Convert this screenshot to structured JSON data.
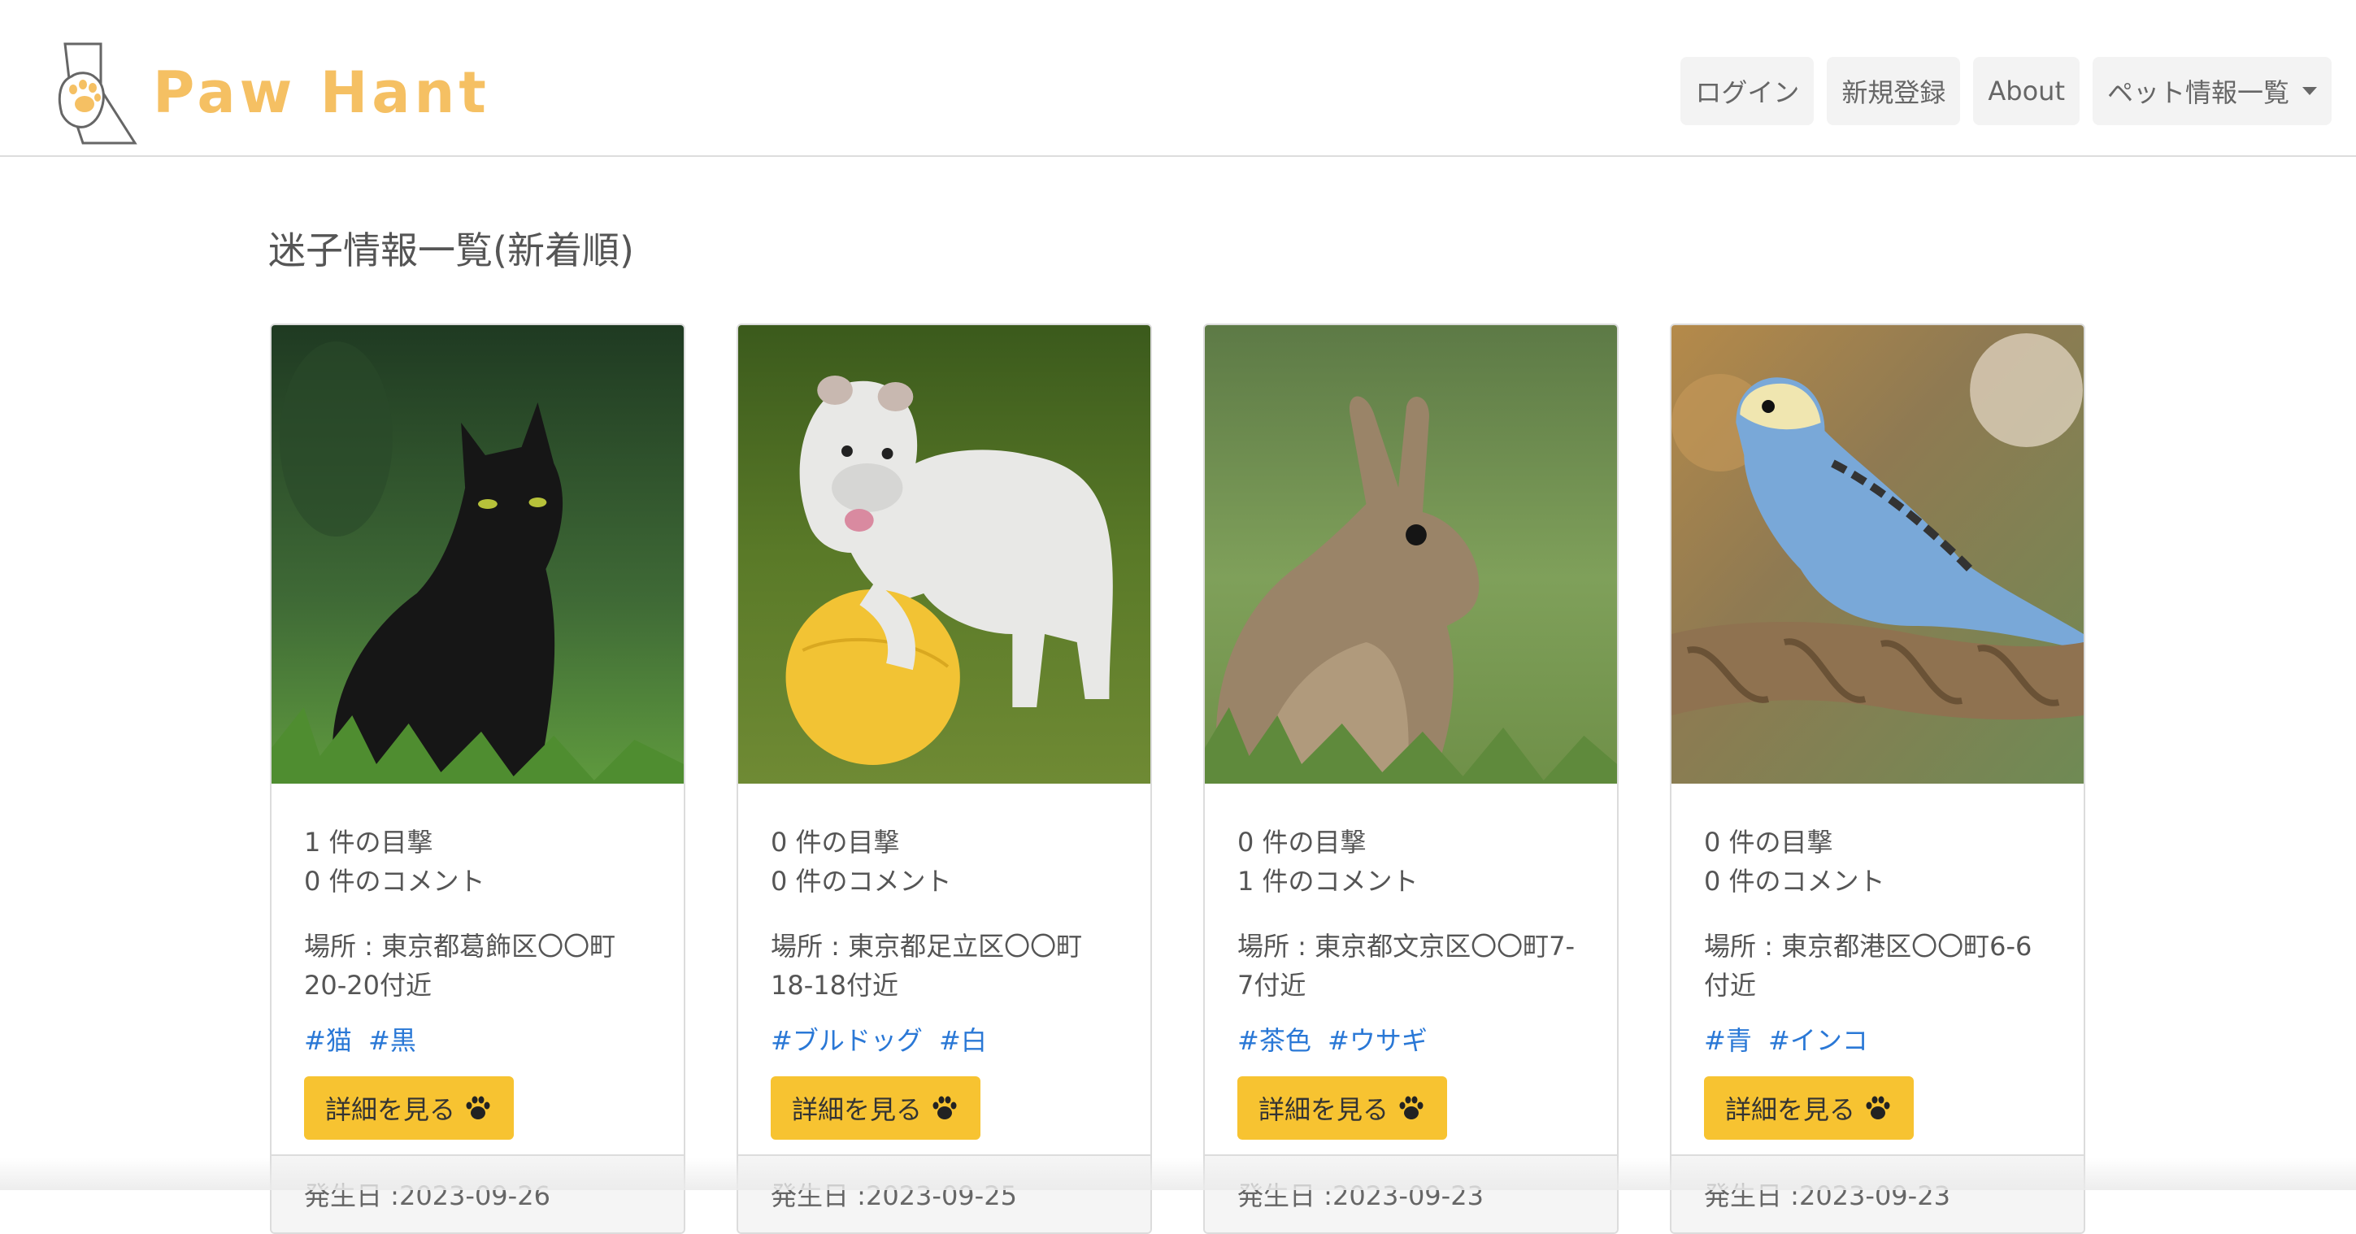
{
  "brand": {
    "name": "Paw Hant",
    "logo_icon": "cat-paw-hand-icon"
  },
  "nav": {
    "login": "ログイン",
    "register": "新規登録",
    "about": "About",
    "pets": "ペット情報一覧"
  },
  "page": {
    "title": "迷子情報一覧(新着順)"
  },
  "cards": [
    {
      "animal": "black-cat",
      "sightings": "1 件の目撃",
      "comments": "0 件のコメント",
      "place": "場所 : 東京都葛飾区〇〇町20-20付近",
      "tags": [
        "#猫",
        "#黒"
      ],
      "button": "詳細を見る",
      "date": "発生日 :2023-09-26"
    },
    {
      "animal": "white-bulldog",
      "sightings": "0 件の目撃",
      "comments": "0 件のコメント",
      "place": "場所 : 東京都足立区〇〇町18-18付近",
      "tags": [
        "#ブルドッグ",
        "#白"
      ],
      "button": "詳細を見る",
      "date": "発生日 :2023-09-25"
    },
    {
      "animal": "brown-rabbit",
      "sightings": "0 件の目撃",
      "comments": "1 件のコメント",
      "place": "場所 : 東京都文京区〇〇町7-7付近",
      "tags": [
        "#茶色",
        "#ウサギ"
      ],
      "button": "詳細を見る",
      "date": "発生日 :2023-09-23"
    },
    {
      "animal": "blue-parakeet",
      "sightings": "0 件の目撃",
      "comments": "0 件のコメント",
      "place": "場所 : 東京都港区〇〇町6-6付近",
      "tags": [
        "#青",
        "#インコ"
      ],
      "button": "詳細を見る",
      "date": "発生日 :2023-09-23"
    }
  ],
  "colors": {
    "brand": "#f5c063",
    "button": "#f7c331",
    "tag": "#2a78d6"
  }
}
